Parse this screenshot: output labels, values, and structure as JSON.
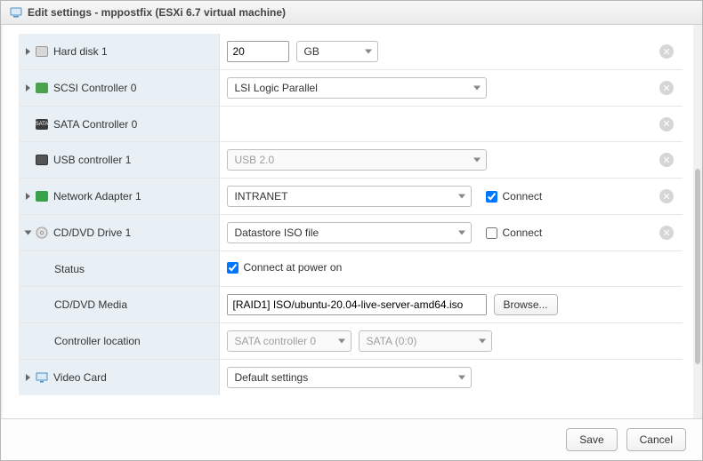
{
  "title": "Edit settings - mppostfix (ESXi 6.7 virtual machine)",
  "rows": {
    "harddisk": {
      "label": "Hard disk 1",
      "value": "20",
      "unit": "GB"
    },
    "scsi": {
      "label": "SCSI Controller 0",
      "value": "LSI Logic Parallel"
    },
    "sata": {
      "label": "SATA Controller 0"
    },
    "usb": {
      "label": "USB controller 1",
      "value": "USB 2.0"
    },
    "nic": {
      "label": "Network Adapter 1",
      "value": "INTRANET",
      "connect_label": "Connect"
    },
    "cd": {
      "label": "CD/DVD Drive 1",
      "value": "Datastore ISO file",
      "connect_label": "Connect"
    },
    "status": {
      "label": "Status",
      "value": "Connect at power on"
    },
    "media": {
      "label": "CD/DVD Media",
      "value": "[RAID1] ISO/ubuntu-20.04-live-server-amd64.iso",
      "browse": "Browse..."
    },
    "ctrlloc": {
      "label": "Controller location",
      "controller": "SATA controller 0",
      "port": "SATA (0:0)"
    },
    "video": {
      "label": "Video Card",
      "value": "Default settings"
    }
  },
  "footer": {
    "save": "Save",
    "cancel": "Cancel"
  }
}
